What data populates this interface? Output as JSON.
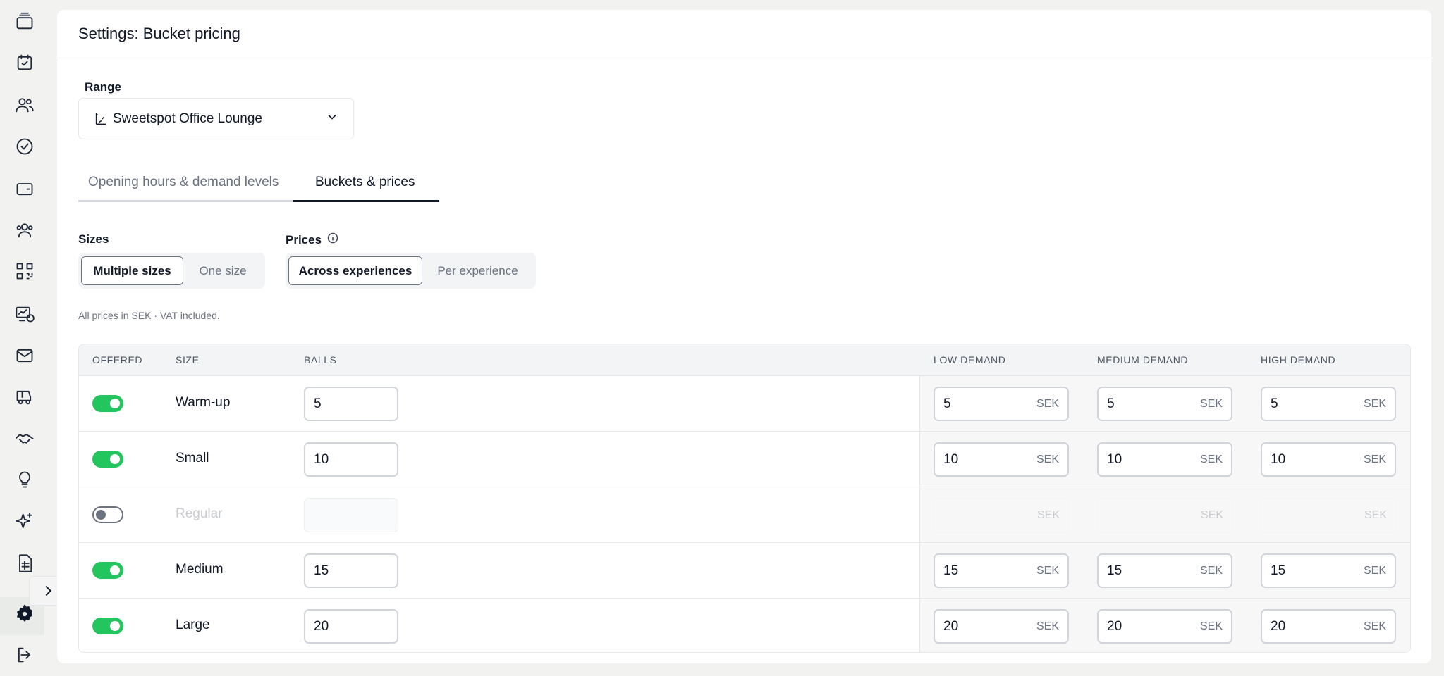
{
  "sidebar": {
    "icons": [
      {
        "name": "bookings-icon"
      },
      {
        "name": "calendar-check-icon"
      },
      {
        "name": "users-icon"
      },
      {
        "name": "badge-check-icon"
      },
      {
        "name": "wallet-icon"
      },
      {
        "name": "members-icon"
      },
      {
        "name": "qr-code-icon"
      },
      {
        "name": "monitor-dollar-icon"
      },
      {
        "name": "mail-icon"
      },
      {
        "name": "golf-cart-icon"
      },
      {
        "name": "handshake-icon"
      },
      {
        "name": "lightbulb-icon"
      },
      {
        "name": "sparkles-icon"
      },
      {
        "name": "spreadsheet-icon"
      },
      {
        "name": "settings-icon"
      },
      {
        "name": "logout-icon"
      }
    ]
  },
  "header": {
    "title": "Settings: Bucket pricing"
  },
  "range": {
    "label": "Range",
    "value": "Sweetspot Office Lounge"
  },
  "tabs": [
    {
      "label": "Opening hours & demand levels",
      "active": false
    },
    {
      "label": "Buckets & prices",
      "active": true
    }
  ],
  "sizes": {
    "label": "Sizes",
    "options": [
      "Multiple sizes",
      "One size"
    ],
    "selected": "Multiple sizes"
  },
  "prices": {
    "label": "Prices",
    "options": [
      "Across experiences",
      "Per experience"
    ],
    "selected": "Across experiences"
  },
  "note": "All prices in SEK · VAT included.",
  "table": {
    "headers": {
      "offered": "OFFERED",
      "size": "SIZE",
      "balls": "BALLS",
      "low": "LOW DEMAND",
      "medium": "MEDIUM DEMAND",
      "high": "HIGH DEMAND"
    },
    "currency": "SEK",
    "rows": [
      {
        "offered": true,
        "size": "Warm-up",
        "balls": "5",
        "low": "5",
        "medium": "5",
        "high": "5"
      },
      {
        "offered": true,
        "size": "Small",
        "balls": "10",
        "low": "10",
        "medium": "10",
        "high": "10"
      },
      {
        "offered": false,
        "size": "Regular",
        "balls": "",
        "low": "",
        "medium": "",
        "high": ""
      },
      {
        "offered": true,
        "size": "Medium",
        "balls": "15",
        "low": "15",
        "medium": "15",
        "high": "15"
      },
      {
        "offered": true,
        "size": "Large",
        "balls": "20",
        "low": "20",
        "medium": "20",
        "high": "20"
      }
    ]
  },
  "colors": {
    "toggle_on": "#22c55e",
    "accent": "#111827"
  }
}
